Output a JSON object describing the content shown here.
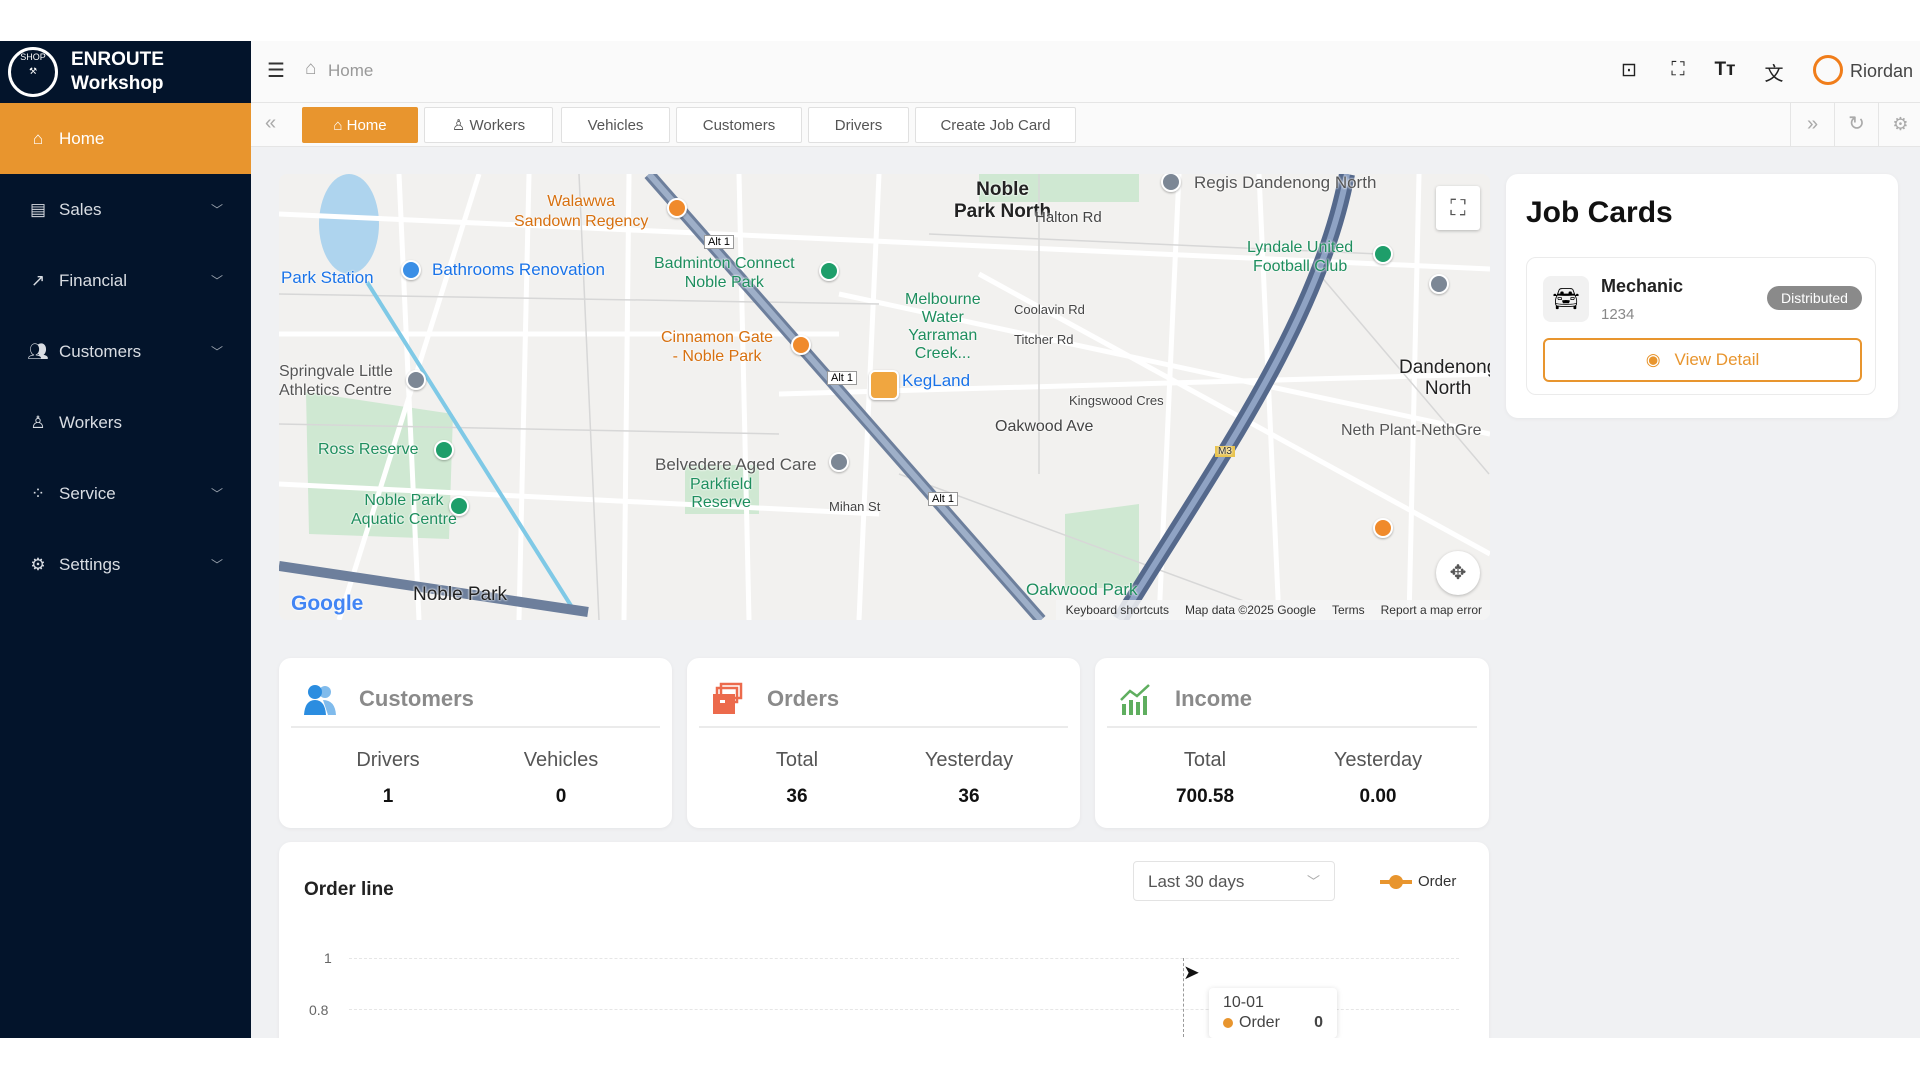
{
  "brand": {
    "line1": "ENROUTE",
    "line2": "Workshop",
    "logo_text": "SHOP"
  },
  "sidebar": {
    "items": [
      {
        "label": "Home",
        "icon": "home-icon",
        "active": true,
        "expandable": false
      },
      {
        "label": "Sales",
        "icon": "archive-icon",
        "expandable": true
      },
      {
        "label": "Financial",
        "icon": "chart-up-icon",
        "expandable": true
      },
      {
        "label": "Customers",
        "icon": "users-icon",
        "expandable": true
      },
      {
        "label": "Workers",
        "icon": "worker-icon",
        "expandable": false
      },
      {
        "label": "Service",
        "icon": "flow-icon",
        "expandable": true
      },
      {
        "label": "Settings",
        "icon": "gear-icon",
        "expandable": true
      }
    ]
  },
  "header": {
    "breadcrumb": "Home",
    "user": "Riordan"
  },
  "tabs": [
    {
      "label": "Home",
      "active": true
    },
    {
      "label": "Workers"
    },
    {
      "label": "Vehicles"
    },
    {
      "label": "Customers"
    },
    {
      "label": "Drivers"
    },
    {
      "label": "Create Job Card"
    }
  ],
  "map": {
    "labels": {
      "noble_park_north_1": "Noble",
      "noble_park_north_2": "Park North",
      "halton": "Halton Rd",
      "walawwa_1": "Walawwa",
      "walawwa_2": "Sandown Regency",
      "regis": "Regis Dandenong North",
      "bathrooms": "Bathrooms Renovation",
      "park_station": "Park Station",
      "badminton_1": "Badminton Connect",
      "badminton_2": "Noble Park",
      "melbourne_water": "Melbourne\nWater\nYarraman\nCreek...",
      "cinnamon_1": "Cinnamon Gate",
      "cinnamon_2": "- Noble Park",
      "kegland": "KegLand",
      "coolavin": "Coolavin Rd",
      "titcher": "Titcher Rd",
      "lyndale_1": "Lyndale United",
      "lyndale_2": "Football Club",
      "dandenong_1": "Dandenong",
      "dandenong_2": "North",
      "neth_plant": "Neth Plant-NethGre",
      "springvale_1": "Springvale Little",
      "springvale_2": "Athletics Centre",
      "ross": "Ross Reserve",
      "aquatic_1": "Noble Park",
      "aquatic_2": "Aquatic Centre",
      "belvedere": "Belvedere Aged Care",
      "parkfield_1": "Parkfield",
      "parkfield_2": "Reserve",
      "oakwood_ave": "Oakwood Ave",
      "kingswood": "Kingswood Cres",
      "mihan": "Mihan St",
      "noble_park": "Noble Park",
      "oakwood_park": "Oakwood Park",
      "alt1": "Alt 1",
      "m3": "M3"
    },
    "logo": "Google",
    "footer": {
      "shortcuts": "Keyboard shortcuts",
      "data": "Map data ©2025 Google",
      "terms": "Terms",
      "report": "Report a map error"
    }
  },
  "job_cards": {
    "title": "Job Cards",
    "items": [
      {
        "title": "Mechanic",
        "number": "1234",
        "status": "Distributed",
        "action": "View Detail"
      }
    ]
  },
  "stats": [
    {
      "title": "Customers",
      "icon": "users-icon",
      "color": "#2b8de0",
      "cols": [
        {
          "label": "Drivers",
          "value": "1"
        },
        {
          "label": "Vehicles",
          "value": "0"
        }
      ]
    },
    {
      "title": "Orders",
      "icon": "orders-icon",
      "color": "#ec6a4c",
      "cols": [
        {
          "label": "Total",
          "value": "36"
        },
        {
          "label": "Yesterday",
          "value": "36"
        }
      ]
    },
    {
      "title": "Income",
      "icon": "income-icon",
      "color": "#5fae5f",
      "cols": [
        {
          "label": "Total",
          "value": "700.58"
        },
        {
          "label": "Yesterday",
          "value": "0.00"
        }
      ]
    }
  ],
  "order_line": {
    "title": "Order line",
    "range_select": "Last 30 days",
    "legend": "Order"
  },
  "chart_data": {
    "type": "line",
    "title": "Order line",
    "series": [
      {
        "name": "Order",
        "color": "#e8952e",
        "points": [
          {
            "x": "10-01",
            "y": 0
          }
        ]
      }
    ],
    "y_ticks": [
      "1",
      "0.8"
    ],
    "ylim": [
      0,
      1
    ],
    "tooltip": {
      "x": "10-01",
      "series": "Order",
      "value": "0"
    }
  },
  "colors": {
    "accent": "#e8952e",
    "sidebar": "#03142b"
  }
}
